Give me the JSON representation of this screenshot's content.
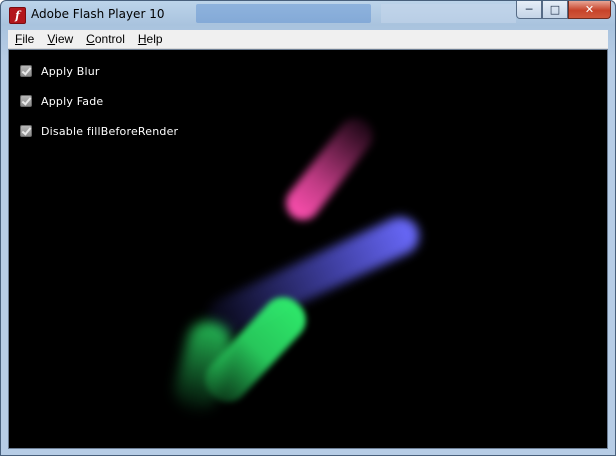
{
  "window": {
    "title": "Adobe Flash Player 10",
    "app_icon_glyph": "f",
    "controls": {
      "minimize": "─",
      "maximize": "□",
      "close": "✕"
    }
  },
  "menu": {
    "items": [
      {
        "label_mn": "F",
        "label_rest": "ile"
      },
      {
        "label_mn": "V",
        "label_rest": "iew"
      },
      {
        "label_mn": "C",
        "label_rest": "ontrol"
      },
      {
        "label_mn": "H",
        "label_rest": "elp"
      }
    ]
  },
  "options": [
    {
      "label": "Apply Blur",
      "checked": true
    },
    {
      "label": "Apply Fade",
      "checked": true
    },
    {
      "label": "Disable fillBeforeRender",
      "checked": true
    }
  ],
  "stage": {
    "background": "#000000",
    "trails": [
      {
        "name": "pink",
        "color": "#ff4fb0"
      },
      {
        "name": "blue",
        "color": "#6b6bff"
      },
      {
        "name": "green",
        "color": "#2ee86a"
      }
    ]
  }
}
